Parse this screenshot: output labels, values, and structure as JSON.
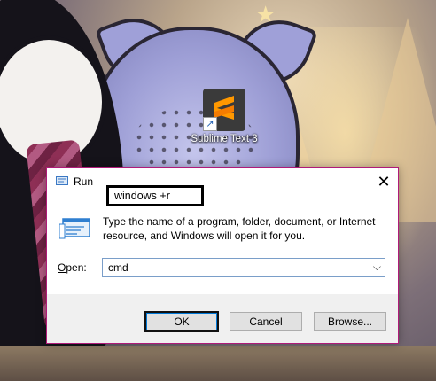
{
  "desktop": {
    "icon": {
      "name": "sublime-text-icon",
      "label": "Sublime Text 3",
      "accent": "#ff9800"
    }
  },
  "annotation": {
    "text": "windows +r"
  },
  "dialog": {
    "title": "Run",
    "close_glyph": "✕",
    "description": "Type the name of a program, folder, document, or Internet resource, and Windows will open it for you.",
    "open_label_prefix": "O",
    "open_label_rest": "pen:",
    "open_value": "cmd",
    "buttons": {
      "ok": "OK",
      "cancel": "Cancel",
      "browse": "Browse..."
    },
    "border_color": "#b01a79"
  }
}
